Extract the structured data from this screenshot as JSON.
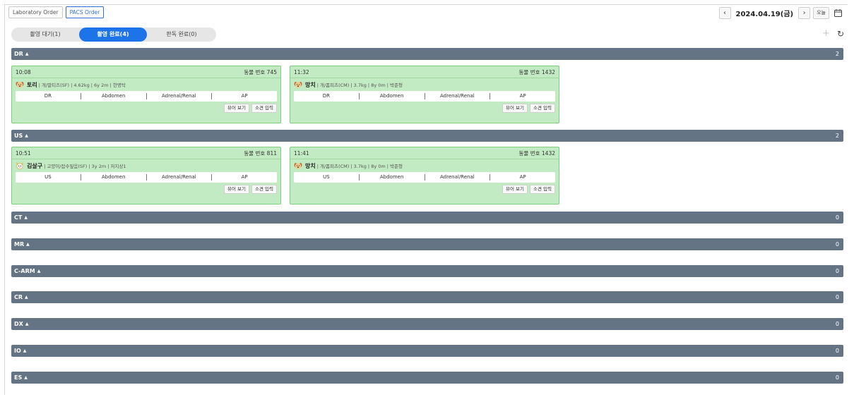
{
  "top_tabs": [
    {
      "label": "Laboratory Order",
      "active": false
    },
    {
      "label": "PACS Order",
      "active": true
    }
  ],
  "date_nav": {
    "date": "2024.04.19(금)",
    "today_label": "오늘"
  },
  "status_tabs": [
    {
      "label": "촬영 대기(1)",
      "active": false
    },
    {
      "label": "촬영 완료(4)",
      "active": true
    },
    {
      "label": "판독 완료(0)",
      "active": false
    }
  ],
  "sections": [
    {
      "name": "DR",
      "count": "2"
    },
    {
      "name": "US",
      "count": "2"
    },
    {
      "name": "CT",
      "count": "0"
    },
    {
      "name": "MR",
      "count": "0"
    },
    {
      "name": "C-ARM",
      "count": "0"
    },
    {
      "name": "CR",
      "count": "0"
    },
    {
      "name": "DX",
      "count": "0"
    },
    {
      "name": "IO",
      "count": "0"
    },
    {
      "name": "ES",
      "count": "0"
    }
  ],
  "cards": [
    {
      "time": "10:08",
      "animal_no": "동물 번호 745",
      "name": "토리",
      "info": "| 개/말티즈(SF) | 4.62kg | 6y 2m | 한명탁",
      "pet": "dog-icon",
      "exam": [
        "DR",
        "Abdomen",
        "Adrenal/Renal",
        "AP"
      ],
      "viewer": "뷰어 보기",
      "finding": "소견 입력"
    },
    {
      "time": "11:32",
      "animal_no": "동물 번호 1432",
      "name": "망치",
      "info": "| 개/폼피츠(CM) | 3.7kg | 8y 0m | 박준형",
      "pet": "dog-icon",
      "exam": [
        "DR",
        "Abdomen",
        "Adrenal/Renal",
        "AP"
      ],
      "viewer": "뷰어 보기",
      "finding": "소견 입력"
    },
    {
      "time": "10:51",
      "animal_no": "동물 번호 811",
      "name": "김살구",
      "info": "| 고양이/잡수잎음(SF) | 3y 2m | 저지상1",
      "pet": "cat-icon",
      "exam": [
        "US",
        "Abdomen",
        "Adrenal/Renal",
        "AP"
      ],
      "viewer": "뷰어 보기",
      "finding": "소견 입력"
    },
    {
      "time": "11:41",
      "animal_no": "동물 번호 1432",
      "name": "망치",
      "info": "| 개/폼피츠(CM) | 3.7kg | 8y 0m | 박준형",
      "pet": "dog-icon",
      "exam": [
        "US",
        "Abdomen",
        "Adrenal/Renal",
        "AP"
      ],
      "viewer": "뷰어 보기",
      "finding": "소견 입력"
    }
  ],
  "colors": {
    "accent": "#1d73e8",
    "section_bar": "#647484",
    "card_bg": "#c3ebc3",
    "card_border": "#7fcd7f"
  }
}
